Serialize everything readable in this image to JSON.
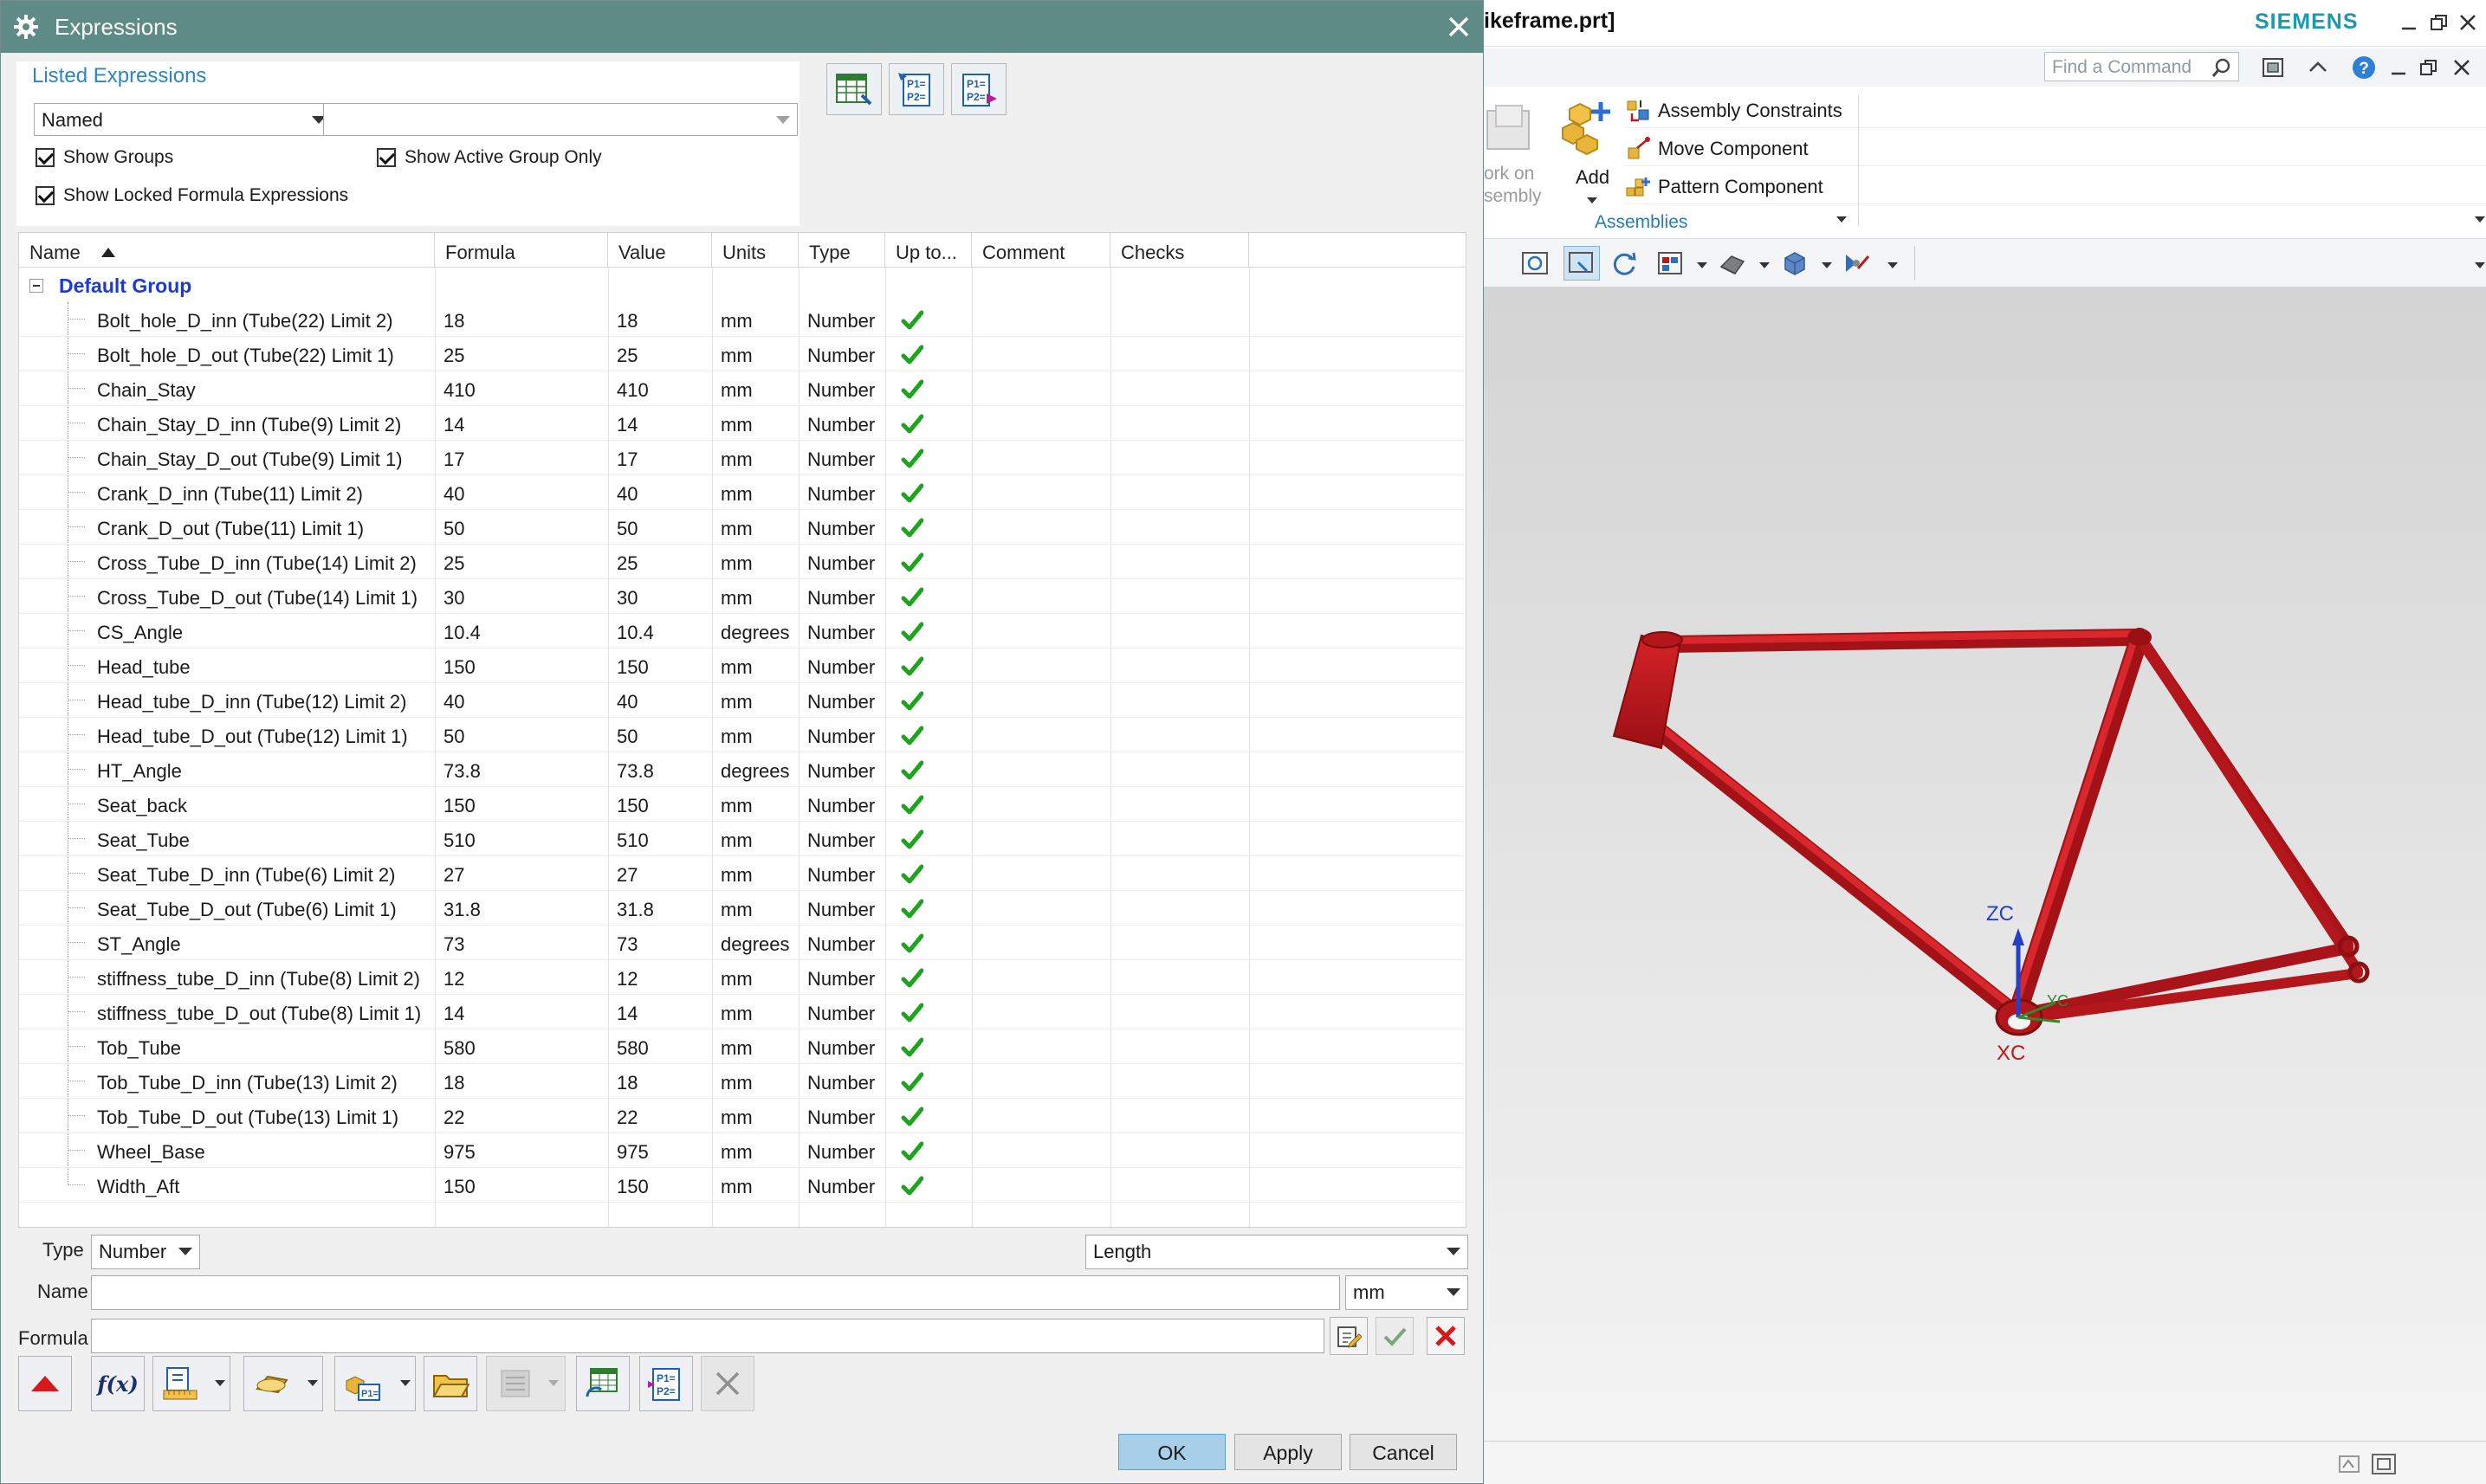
{
  "nx_window": {
    "title": "ikeframe.prt]",
    "brand": "SIEMENS",
    "find_placeholder": "Find a Command",
    "ribbon": {
      "work_on_assembly": [
        "ork on",
        "sembly"
      ],
      "add_label": "Add",
      "items": [
        "Assembly Constraints",
        "Move Component",
        "Pattern Component"
      ],
      "group_label": "Assemblies"
    },
    "csys_labels": {
      "zc": "ZC",
      "xc": "XC",
      "yc": "YC"
    },
    "frame_color": "#c0171b",
    "accent": "#1a9aae"
  },
  "dialog": {
    "title": "Expressions",
    "title_bar_color": "#5e8b85",
    "listed_expressions": {
      "header": "Listed Expressions",
      "filter_value": "Named",
      "search_value": "",
      "show_groups": "Show Groups",
      "show_active_group_only": "Show Active Group Only",
      "show_locked": "Show Locked Formula Expressions"
    },
    "columns": [
      "Name",
      "Formula",
      "Value",
      "Units",
      "Type",
      "Up to...",
      "Comment",
      "Checks"
    ],
    "group_name": "Default Group",
    "rows": [
      {
        "name": "Bolt_hole_D_inn  (Tube(22) Limit 2)",
        "formula": "18",
        "value": "18",
        "units": "mm",
        "type": "Number"
      },
      {
        "name": "Bolt_hole_D_out  (Tube(22) Limit 1)",
        "formula": "25",
        "value": "25",
        "units": "mm",
        "type": "Number"
      },
      {
        "name": "Chain_Stay",
        "formula": "410",
        "value": "410",
        "units": "mm",
        "type": "Number"
      },
      {
        "name": "Chain_Stay_D_inn  (Tube(9) Limit 2)",
        "formula": "14",
        "value": "14",
        "units": "mm",
        "type": "Number"
      },
      {
        "name": "Chain_Stay_D_out  (Tube(9) Limit 1)",
        "formula": "17",
        "value": "17",
        "units": "mm",
        "type": "Number"
      },
      {
        "name": "Crank_D_inn  (Tube(11) Limit 2)",
        "formula": "40",
        "value": "40",
        "units": "mm",
        "type": "Number"
      },
      {
        "name": "Crank_D_out  (Tube(11) Limit 1)",
        "formula": "50",
        "value": "50",
        "units": "mm",
        "type": "Number"
      },
      {
        "name": "Cross_Tube_D_inn  (Tube(14) Limit 2)",
        "formula": "25",
        "value": "25",
        "units": "mm",
        "type": "Number"
      },
      {
        "name": "Cross_Tube_D_out  (Tube(14) Limit 1)",
        "formula": "30",
        "value": "30",
        "units": "mm",
        "type": "Number"
      },
      {
        "name": "CS_Angle",
        "formula": "10.4",
        "value": "10.4",
        "units": "degrees",
        "type": "Number"
      },
      {
        "name": "Head_tube",
        "formula": "150",
        "value": "150",
        "units": "mm",
        "type": "Number"
      },
      {
        "name": "Head_tube_D_inn  (Tube(12) Limit 2)",
        "formula": "40",
        "value": "40",
        "units": "mm",
        "type": "Number"
      },
      {
        "name": "Head_tube_D_out  (Tube(12) Limit 1)",
        "formula": "50",
        "value": "50",
        "units": "mm",
        "type": "Number"
      },
      {
        "name": "HT_Angle",
        "formula": "73.8",
        "value": "73.8",
        "units": "degrees",
        "type": "Number"
      },
      {
        "name": "Seat_back",
        "formula": "150",
        "value": "150",
        "units": "mm",
        "type": "Number"
      },
      {
        "name": "Seat_Tube",
        "formula": "510",
        "value": "510",
        "units": "mm",
        "type": "Number"
      },
      {
        "name": "Seat_Tube_D_inn  (Tube(6) Limit 2)",
        "formula": "27",
        "value": "27",
        "units": "mm",
        "type": "Number"
      },
      {
        "name": "Seat_Tube_D_out  (Tube(6) Limit 1)",
        "formula": "31.8",
        "value": "31.8",
        "units": "mm",
        "type": "Number"
      },
      {
        "name": "ST_Angle",
        "formula": "73",
        "value": "73",
        "units": "degrees",
        "type": "Number"
      },
      {
        "name": "stiffness_tube_D_inn  (Tube(8) Limit 2)",
        "formula": "12",
        "value": "12",
        "units": "mm",
        "type": "Number"
      },
      {
        "name": "stiffness_tube_D_out  (Tube(8) Limit 1)",
        "formula": "14",
        "value": "14",
        "units": "mm",
        "type": "Number"
      },
      {
        "name": "Tob_Tube",
        "formula": "580",
        "value": "580",
        "units": "mm",
        "type": "Number"
      },
      {
        "name": "Tob_Tube_D_inn  (Tube(13) Limit 2)",
        "formula": "18",
        "value": "18",
        "units": "mm",
        "type": "Number"
      },
      {
        "name": "Tob_Tube_D_out  (Tube(13) Limit 1)",
        "formula": "22",
        "value": "22",
        "units": "mm",
        "type": "Number"
      },
      {
        "name": "Wheel_Base",
        "formula": "975",
        "value": "975",
        "units": "mm",
        "type": "Number"
      },
      {
        "name": "Width_Aft",
        "formula": "150",
        "value": "150",
        "units": "mm",
        "type": "Number"
      }
    ],
    "editor": {
      "type_label": "Type",
      "type_value": "Number",
      "dimension_value": "Length",
      "name_label": "Name",
      "name_value": "",
      "units_value": "mm",
      "formula_label": "Formula",
      "formula_value": ""
    },
    "fx_label": "f(x)",
    "buttons": {
      "ok": "OK",
      "apply": "Apply",
      "cancel": "Cancel"
    },
    "check_color": "#1aa51a"
  }
}
